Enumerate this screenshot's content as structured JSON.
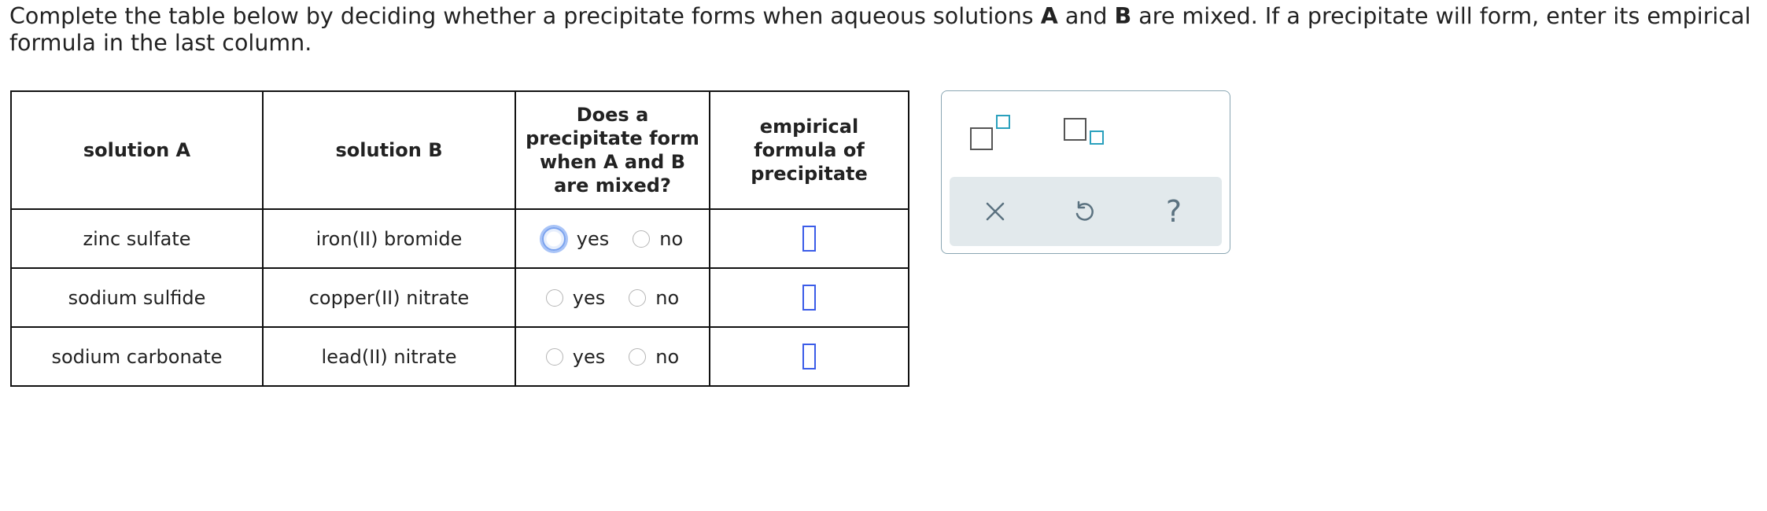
{
  "instructions": {
    "part1": "Complete the table below by deciding whether a precipitate forms when aqueous solutions ",
    "a": "A",
    "part2": " and ",
    "b": "B",
    "part3": " are mixed. If a precipitate will form, enter its empirical formula in the last column."
  },
  "table": {
    "headers": {
      "solution_a": "solution A",
      "solution_b": "solution B",
      "precipitate": "Does a precipitate form when A and B are mixed?",
      "formula": "empirical formula of precipitate"
    },
    "rows": [
      {
        "a": "zinc sulfate",
        "b": "iron(II) bromide",
        "yes": "yes",
        "no": "no"
      },
      {
        "a": "sodium sulfide",
        "b": "copper(II) nitrate",
        "yes": "yes",
        "no": "no"
      },
      {
        "a": "sodium carbonate",
        "b": "lead(II) nitrate",
        "yes": "yes",
        "no": "no"
      }
    ]
  },
  "palette": {
    "icons": [
      "superscript-icon",
      "subscript-icon",
      "close-icon",
      "undo-icon",
      "help-icon"
    ],
    "help_glyph": "?"
  },
  "colors": {
    "answer_box": "#3b5ce8",
    "palette_accent": "#2aa0bd",
    "palette_bar": "#e2e9ec",
    "focus_ring": "#7aa2ee"
  }
}
